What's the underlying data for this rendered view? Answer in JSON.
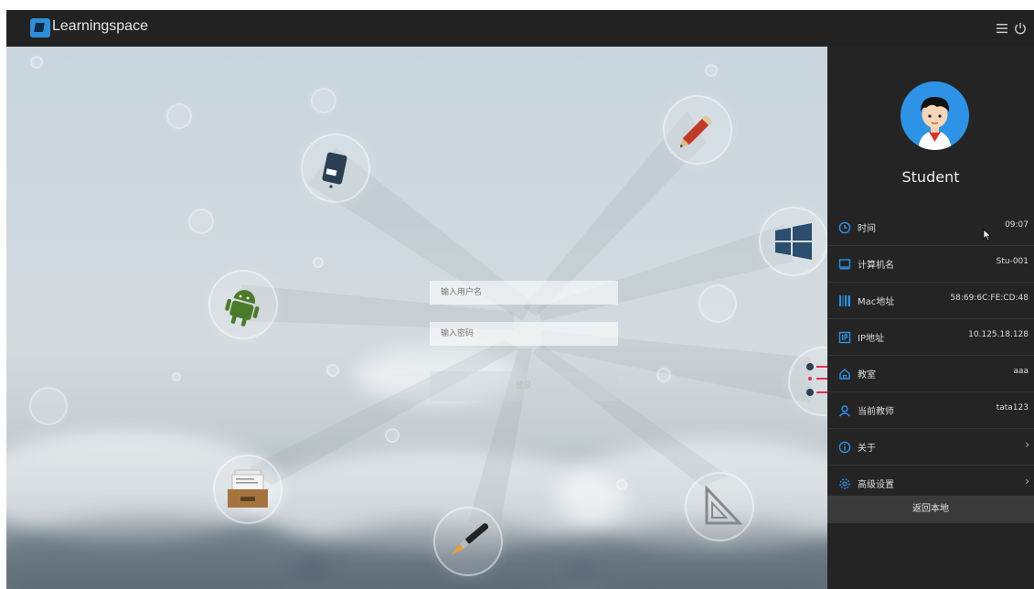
{
  "header": {
    "app_title": "Learningspace",
    "menu_icon": "hamburger-menu-icon",
    "power_icon": "power-icon"
  },
  "login": {
    "username_placeholder": "输入用户名",
    "password_placeholder": "输入密码",
    "login_button": "登录"
  },
  "profile": {
    "username": "Student",
    "avatar_icon": "student-avatar-icon"
  },
  "info": [
    {
      "icon": "clock-icon",
      "label": "时间",
      "value": "09:07"
    },
    {
      "icon": "monitor-icon",
      "label": "计算机名",
      "value": "Stu-001"
    },
    {
      "icon": "barcode-icon",
      "label": "Mac地址",
      "value": "58:69:6C:FE:CD:48"
    },
    {
      "icon": "ip-icon",
      "label": "IP地址",
      "value": "10.125.18.128"
    },
    {
      "icon": "home-icon",
      "label": "教室",
      "value": "aaa"
    },
    {
      "icon": "user-icon",
      "label": "当前教师",
      "value": "tata123"
    }
  ],
  "menu": [
    {
      "icon": "info-icon",
      "label": "关于",
      "chevron": "›"
    },
    {
      "icon": "gear-icon",
      "label": "高级设置",
      "chevron": "›"
    }
  ],
  "back_button": "返回本地",
  "colors": {
    "accent": "#2e92e6",
    "sidebar_bg": "#242424",
    "topbar_bg": "#222222"
  },
  "apps": [
    {
      "icon": "tablet-icon"
    },
    {
      "icon": "pencil-icon"
    },
    {
      "icon": "windows-icon"
    },
    {
      "icon": "android-icon"
    },
    {
      "icon": "chart-list-icon"
    },
    {
      "icon": "file-drawer-icon"
    },
    {
      "icon": "paintbrush-icon"
    },
    {
      "icon": "set-square-icon"
    }
  ]
}
